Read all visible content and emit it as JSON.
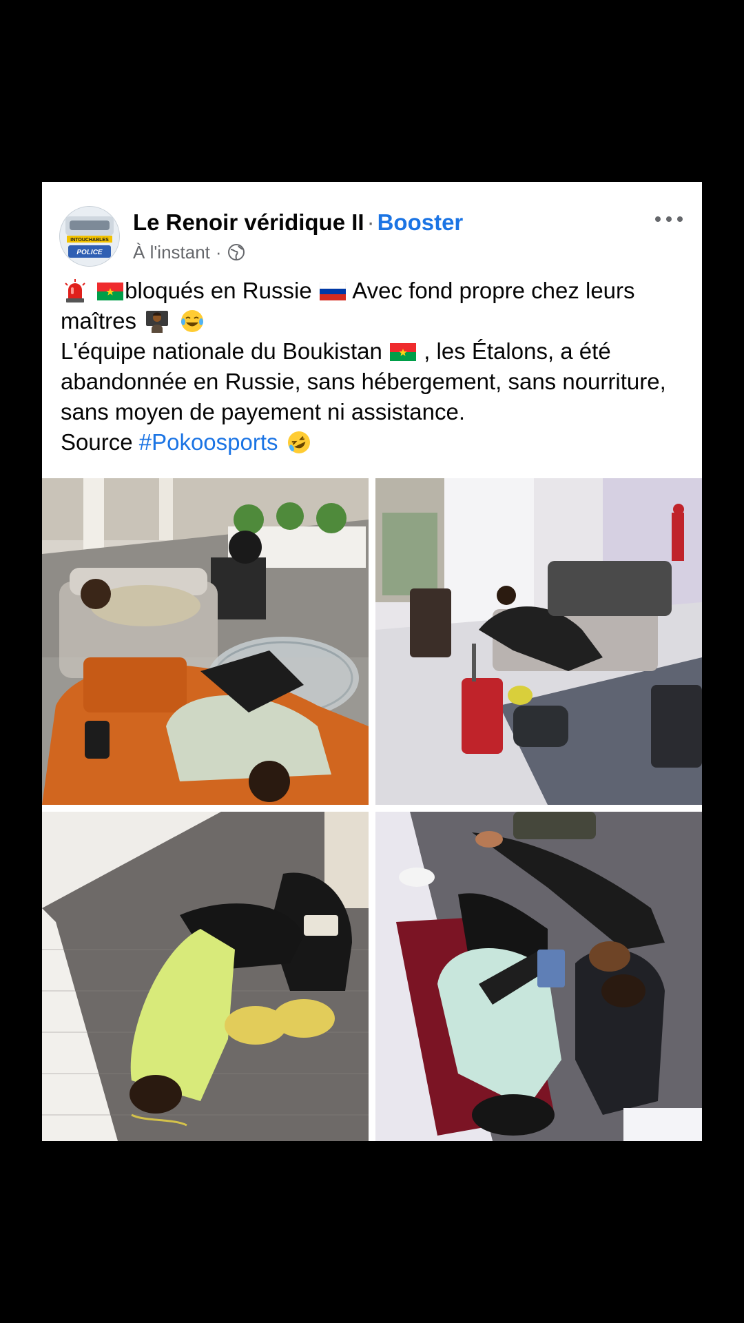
{
  "post": {
    "author": "Le Renoir véridique II",
    "separator": "·",
    "boost_label": "Booster",
    "timestamp": "À l'instant",
    "meta_separator": "·",
    "audience_icon": "globe-icon",
    "more_icon": "more-horizontal-icon",
    "avatar_text": "INTOUCHABLES",
    "avatar_badge": "POLICE",
    "text": {
      "line1_a": "bloqués en Russie",
      "line1_b": "Avec fond propre chez leurs maîtres",
      "para2_a": "L'équipe nationale du Boukistan",
      "para2_b": ", les Étalons, a été abandonnée en Russie, sans hébergement, sans nourriture, sans moyen de payement ni assistance.",
      "source_label": "Source",
      "hashtag": "#Pokoosports"
    },
    "emojis": [
      "rotating-light-emoji",
      "burkina-faso-flag",
      "russia-flag",
      "person-at-easel-emoji",
      "tears-of-joy-emoji",
      "burkina-faso-flag",
      "rolling-laughing-emoji"
    ]
  },
  "colors": {
    "link": "#1b74e4",
    "text": "#050505",
    "muted": "#65676b",
    "background": "#000000",
    "card": "#ffffff"
  },
  "photos": [
    {
      "name": "photo-player-sleeping-on-sofa"
    },
    {
      "name": "photo-players-in-hotel-lobby"
    },
    {
      "name": "photo-player-on-carpet-yellow-hoodie"
    },
    {
      "name": "photo-players-lying-on-floor"
    }
  ]
}
